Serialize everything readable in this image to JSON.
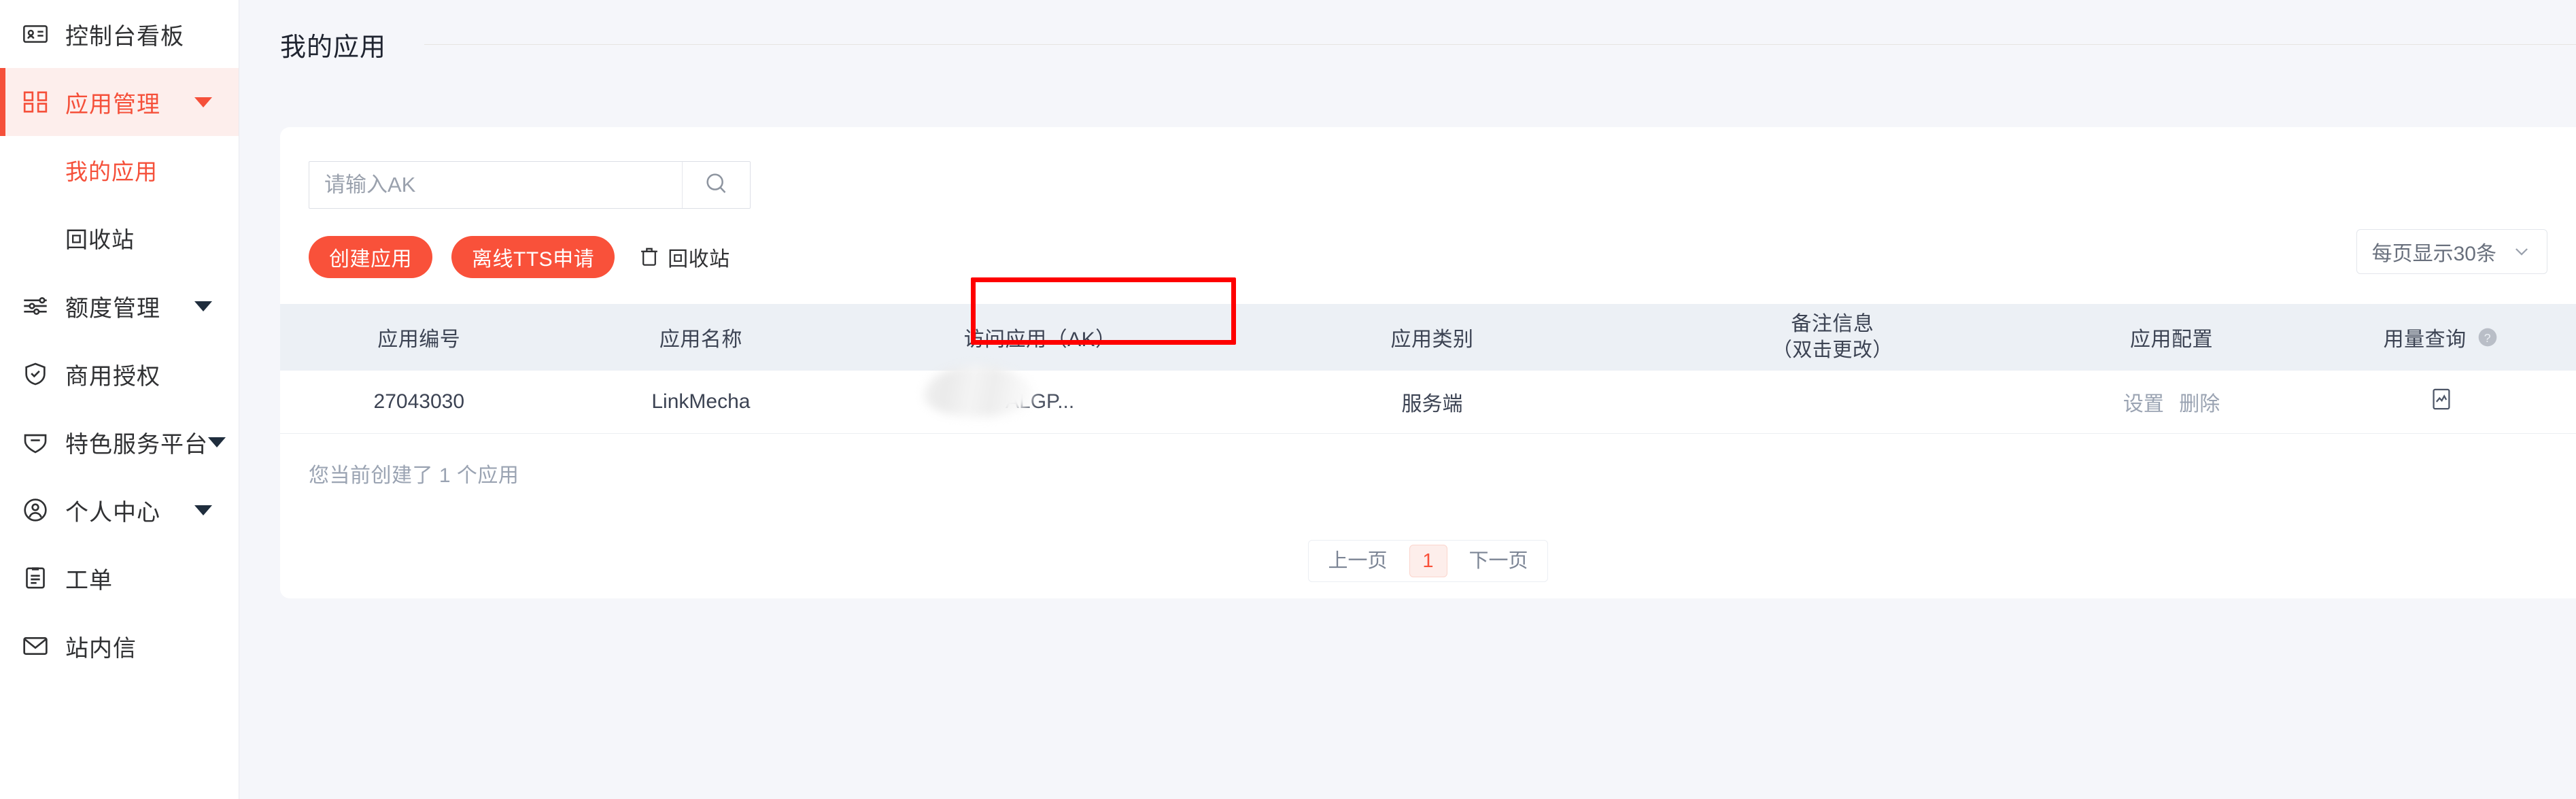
{
  "sidebar": {
    "items": [
      {
        "label": "控制台看板",
        "icon": "dashboard-card-icon",
        "active": false,
        "expandable": false
      },
      {
        "label": "应用管理",
        "icon": "apps-grid-icon",
        "active": true,
        "expandable": true
      },
      {
        "label": "额度管理",
        "icon": "sliders-icon",
        "active": false,
        "expandable": true
      },
      {
        "label": "商用授权",
        "icon": "shield-check-icon",
        "active": false,
        "expandable": false
      },
      {
        "label": "特色服务平台",
        "icon": "badge-icon",
        "active": false,
        "expandable": true
      },
      {
        "label": "个人中心",
        "icon": "user-circle-icon",
        "active": false,
        "expandable": true
      },
      {
        "label": "工单",
        "icon": "clipboard-icon",
        "active": false,
        "expandable": false
      },
      {
        "label": "站内信",
        "icon": "envelope-icon",
        "active": false,
        "expandable": false
      }
    ],
    "subitems": [
      {
        "label": "我的应用",
        "active": true
      },
      {
        "label": "回收站",
        "active": false
      }
    ]
  },
  "header": {
    "title": "我的应用"
  },
  "search": {
    "placeholder": "请输入AK",
    "value": "",
    "icon": "search-icon"
  },
  "toolbar": {
    "create_app_label": "创建应用",
    "offline_tts_label": "离线TTS申请",
    "recycle_bin_label": "回收站",
    "recycle_bin_icon": "trash-icon",
    "page_size_label": "每页显示30条",
    "page_size_icon": "chevron-down-icon"
  },
  "table": {
    "columns": [
      {
        "key": "app_id",
        "label": "应用编号",
        "sublabel": ""
      },
      {
        "key": "app_name",
        "label": "应用名称",
        "sublabel": ""
      },
      {
        "key": "ak",
        "label": "访问应用（AK）",
        "sublabel": "",
        "highlighted": true
      },
      {
        "key": "app_type",
        "label": "应用类别",
        "sublabel": ""
      },
      {
        "key": "remark",
        "label": "备注信息",
        "sublabel": "（双击更改）"
      },
      {
        "key": "app_config",
        "label": "应用配置",
        "sublabel": ""
      },
      {
        "key": "usage_query",
        "label": "用量查询",
        "sublabel": "",
        "help_icon": "question-circle-icon"
      }
    ],
    "rows": [
      {
        "app_id": "27043030",
        "app_name": "LinkMecha",
        "ak": "ALGP...",
        "ak_masked": true,
        "app_type": "服务端",
        "remark": "",
        "app_config_actions": [
          "设置",
          "删除"
        ],
        "usage_query_icon": "chart-line-icon"
      }
    ],
    "count_note": "您当前创建了 1 个应用"
  },
  "pagination": {
    "prev_label": "上一页",
    "next_label": "下一页",
    "current_page": "1"
  },
  "colors": {
    "brand": "#f9513a",
    "brand_soft_bg": "#fdeeec",
    "annotation": "#fe0000",
    "page_bg": "#f5f6fa",
    "table_head_bg": "#ecf0f5"
  },
  "annotation": {
    "target": "访问应用（AK）",
    "color": "#fe0000"
  }
}
